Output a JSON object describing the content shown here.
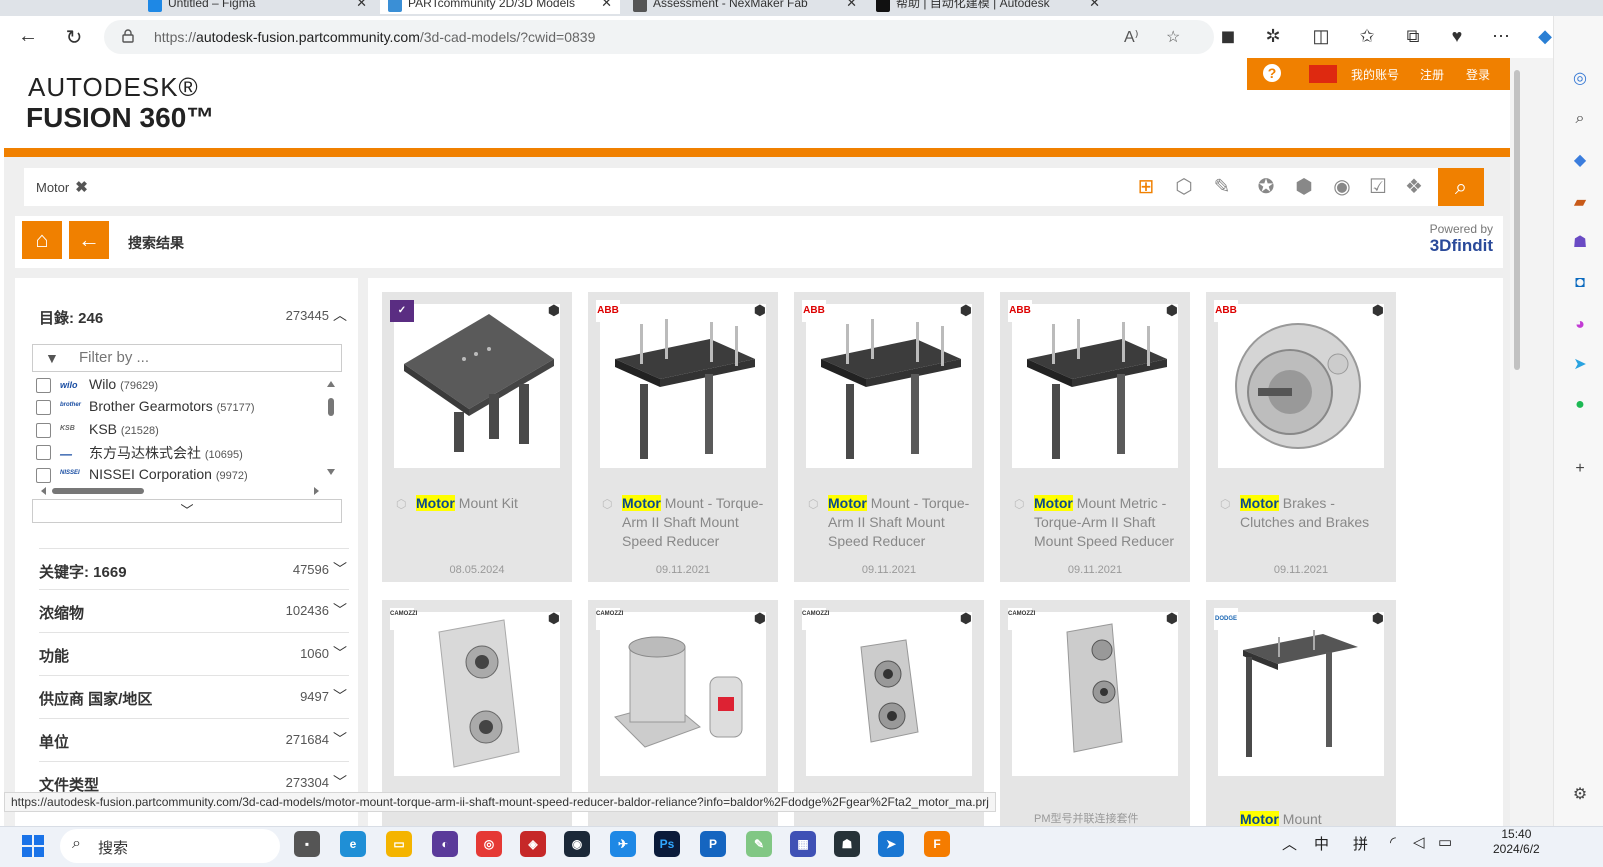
{
  "browser": {
    "tabs": [
      {
        "label": "Untitled – Figma",
        "color": "#1e88e5"
      },
      {
        "label": "PARTcommunity 2D/3D Models",
        "color": "#3a8fd6"
      },
      {
        "label": "Assessment - NexMaker Fab",
        "color": "#555555"
      },
      {
        "label": "帮助 | 自动化建模 | Autodesk",
        "color": "#111111"
      }
    ],
    "url_prefix": "https://",
    "url_host": "autodesk-fusion.partcommunity.com",
    "url_path": "/3d-cad-models/?cwid=0839"
  },
  "site": {
    "logo_line1": "AUTODESK®",
    "logo_line2": "FUSION 360™",
    "top_links": [
      "我的账号",
      "注册",
      "登录"
    ]
  },
  "search": {
    "chip_label": "Motor"
  },
  "crumb": {
    "title": "搜索结果",
    "powered_by": "Powered by",
    "brand": "3Dfindit"
  },
  "filters": {
    "catalog": {
      "label": "目錄: 246",
      "count": "273445"
    },
    "filter_placeholder": "Filter by ...",
    "manufacturers": [
      {
        "logo": "wilo",
        "name": "Wilo",
        "count": "(79629)"
      },
      {
        "logo": "brother",
        "name": "Brother Gearmotors",
        "count": "(57177)"
      },
      {
        "logo": "KSB",
        "name": "KSB",
        "count": "(21528)"
      },
      {
        "logo": "—",
        "name": "东方马达株式会社",
        "count": "(10695)"
      },
      {
        "logo": "NISSEI",
        "name": "NISSEI Corporation",
        "count": "(9972)"
      }
    ],
    "groups": [
      {
        "label": "关键字: 1669",
        "count": "47596"
      },
      {
        "label": "浓缩物",
        "count": "102436"
      },
      {
        "label": "功能",
        "count": "1060"
      },
      {
        "label": "供应商 国家/地区",
        "count": "9497"
      },
      {
        "label": "单位",
        "count": "271684"
      },
      {
        "label": "文件类型",
        "count": "273304"
      }
    ]
  },
  "results": [
    {
      "badge": "✓",
      "badge_style": "purple",
      "highlight": "Motor",
      "rest": " Mount Kit",
      "date": "08.05.2024"
    },
    {
      "badge": "ABB",
      "badge_style": "abb",
      "highlight": "Motor",
      "rest": " Mount - Torque-Arm II Shaft Mount Speed Reducer",
      "date": "09.11.2021"
    },
    {
      "badge": "ABB",
      "badge_style": "abb",
      "highlight": "Motor",
      "rest": " Mount - Torque-Arm II Shaft Mount Speed Reducer",
      "date": "09.11.2021"
    },
    {
      "badge": "ABB",
      "badge_style": "abb",
      "highlight": "Motor",
      "rest": " Mount Metric - Torque-Arm II Shaft Mount Speed Reducer",
      "date": "09.11.2021"
    },
    {
      "badge": "ABB",
      "badge_style": "abb",
      "highlight": "Motor",
      "rest": " Brakes - Clutches and Brakes",
      "date": "09.11.2021"
    },
    {
      "badge": "CAMOZZI",
      "badge_style": "cam",
      "highlight": "",
      "rest": "",
      "date": ""
    },
    {
      "badge": "CAMOZZI",
      "badge_style": "cam",
      "highlight": "",
      "rest": "",
      "date": ""
    },
    {
      "badge": "CAMOZZI",
      "badge_style": "cam",
      "highlight": "",
      "rest": "",
      "date": ""
    },
    {
      "badge": "CAMOZZI",
      "badge_style": "cam",
      "highlight": "",
      "rest": "PM型号并联连接套件",
      "date": ""
    },
    {
      "badge": "DODGE",
      "badge_style": "dodge",
      "highlight": "Motor",
      "rest": " Mount",
      "date": ""
    }
  ],
  "status_url": "https://autodesk-fusion.partcommunity.com/3d-cad-models/motor-mount-torque-arm-ii-shaft-mount-speed-reducer-baldor-reliance?info=baldor%2Fdodge%2Fgear%2Fta2_motor_ma.prj",
  "taskbar": {
    "search_label": "搜索",
    "ime1": "中",
    "ime2": "拼",
    "time": "15:40",
    "date": "2024/6/2"
  }
}
